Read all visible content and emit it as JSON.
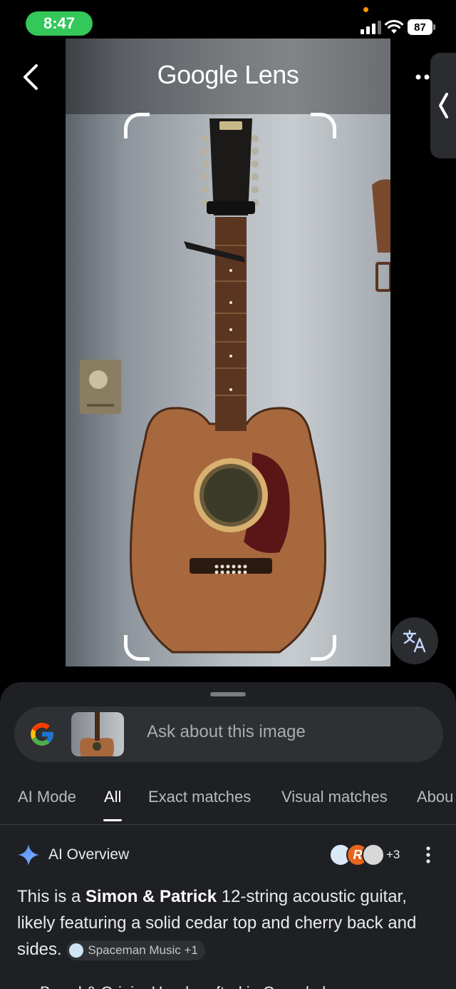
{
  "status_bar": {
    "time": "8:47",
    "battery": "87"
  },
  "header": {
    "title": "Google Lens"
  },
  "search": {
    "placeholder": "Ask about this image"
  },
  "tabs": [
    {
      "label": "AI Mode",
      "active": false
    },
    {
      "label": "All",
      "active": true
    },
    {
      "label": "Exact matches",
      "active": false
    },
    {
      "label": "Visual matches",
      "active": false
    },
    {
      "label": "Abou",
      "active": false
    }
  ],
  "ai_overview": {
    "title": "AI Overview",
    "source_count": "+3",
    "text_before": "This is a ",
    "text_bold": "Simon & Patrick",
    "text_after": " 12-string acoustic guitar, likely featuring a solid cedar top and cherry back and sides. ",
    "chip_label": "Spaceman Music +1",
    "next_line": "Brand & Origin: Hand-crafted in Canada by"
  },
  "colors": {
    "status_green": "#34c759",
    "sheet_bg": "#1f2023",
    "accent_blue": "#4285f4"
  },
  "icons": [
    "back-arrow-icon",
    "more-dots-icon",
    "collapse-chevron-icon",
    "translate-icon",
    "google-g-icon",
    "sparkle-icon",
    "kebab-menu-icon"
  ]
}
